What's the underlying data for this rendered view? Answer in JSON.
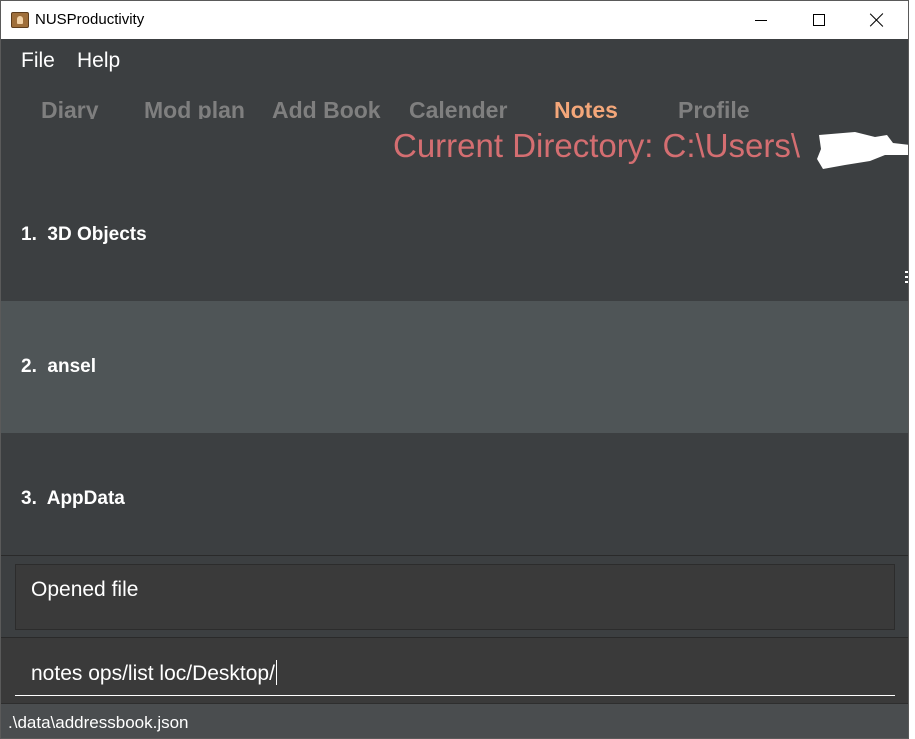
{
  "window": {
    "title": "NUSProductivity",
    "icon": "app-icon",
    "controls": {
      "minimize": "minimize-icon",
      "maximize": "maximize-icon",
      "close": "close-icon"
    }
  },
  "menubar": {
    "items": [
      {
        "label": "File"
      },
      {
        "label": "Help"
      }
    ]
  },
  "tabs": [
    {
      "label": "Diary",
      "active": false
    },
    {
      "label": "Mod plan",
      "active": false
    },
    {
      "label": "Add Book",
      "active": false
    },
    {
      "label": "Calender",
      "active": false
    },
    {
      "label": "Notes",
      "active": true
    },
    {
      "label": "Profile",
      "active": false
    }
  ],
  "current_directory": {
    "text": "Current Directory: C:\\Users\\"
  },
  "file_list": {
    "items": [
      {
        "index": "1.",
        "name": "3D Objects"
      },
      {
        "index": "2.",
        "name": "ansel"
      },
      {
        "index": "3.",
        "name": "AppData"
      }
    ]
  },
  "result_display": {
    "text": "Opened file"
  },
  "command_box": {
    "value": "notes ops/list loc/Desktop/"
  },
  "status_bar": {
    "path": ".\\data\\addressbook.json"
  },
  "colors": {
    "background": "#3c3f41",
    "tab_inactive": "#7f7f7f",
    "tab_active": "#f4a77a",
    "directory_text": "#d46e71",
    "row_even": "#3c3f41",
    "row_odd": "#4f5557",
    "status_bar": "#4a4d4f"
  }
}
